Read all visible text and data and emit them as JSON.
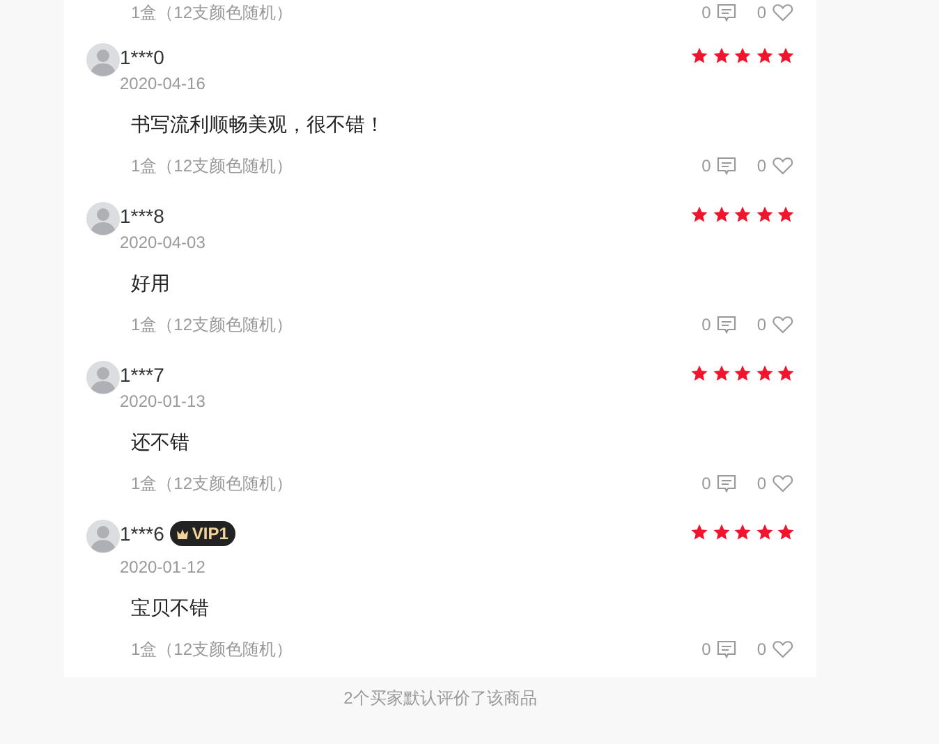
{
  "previous_review_footer": {
    "spec": "1盒（12支颜色随机）",
    "comments": "0",
    "likes": "0"
  },
  "reviews": [
    {
      "user": "1***0",
      "date": "2020-04-16",
      "text": "书写流利顺畅美观，很不错！",
      "spec": "1盒（12支颜色随机）",
      "comments": "0",
      "likes": "0",
      "stars": 5
    },
    {
      "user": "1***8",
      "date": "2020-04-03",
      "text": "好用",
      "spec": "1盒（12支颜色随机）",
      "comments": "0",
      "likes": "0",
      "stars": 5
    },
    {
      "user": "1***7",
      "date": "2020-01-13",
      "text": "还不错",
      "spec": "1盒（12支颜色随机）",
      "comments": "0",
      "likes": "0",
      "stars": 5
    },
    {
      "user": "1***6",
      "vip_badge": "VIP1",
      "date": "2020-01-12",
      "text": "宝贝不错",
      "spec": "1盒（12支颜色随机）",
      "comments": "0",
      "likes": "0",
      "stars": 5
    }
  ],
  "default_reviews_note": "2个买家默认评价了该商品"
}
